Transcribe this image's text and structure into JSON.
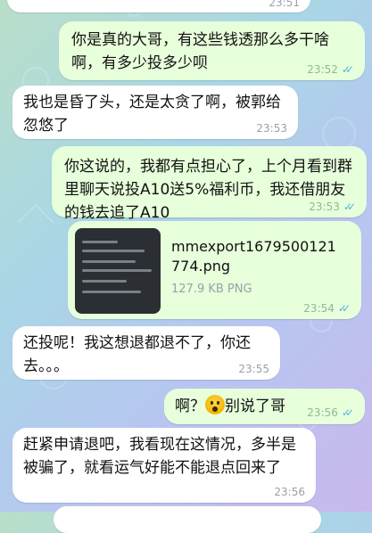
{
  "chat": {
    "messages": [
      {
        "direction": "in",
        "text": "",
        "time": "23:51"
      },
      {
        "direction": "out",
        "text": "你是真的大哥，有这些钱透那么多干啥啊，有多少投多少呗",
        "time": "23:52"
      },
      {
        "direction": "in",
        "text": "我也是昏了头，还是太贪了啊，被郭给忽悠了",
        "time": "23:53"
      },
      {
        "direction": "out",
        "text": "你这说的，我都有点担心了，上个月看到群里聊天说投A10送5%福利币，我还借朋友的钱去追了A10",
        "time": "23:53"
      },
      {
        "direction": "out",
        "type": "file",
        "file_name": "mmexport1679500121774.png",
        "file_size": "127.9 KB PNG",
        "time": "23:54"
      },
      {
        "direction": "in",
        "text": "还投呢！我这想退都退不了，你还去。。。",
        "time": "23:55"
      },
      {
        "direction": "out",
        "text_before": "啊？",
        "emoji": "face-screaming-in-fear",
        "text_after": "别说了哥",
        "time": "23:56"
      },
      {
        "direction": "in",
        "text": "赶紧申请退吧，我看现在这情况，多半是被骗了，就看运气好能不能退点回来了",
        "time": "23:56"
      }
    ]
  },
  "colors": {
    "incoming": "#ffffff",
    "outgoing": "#e7ffdb",
    "read_ticks": "#4fb6e6"
  }
}
